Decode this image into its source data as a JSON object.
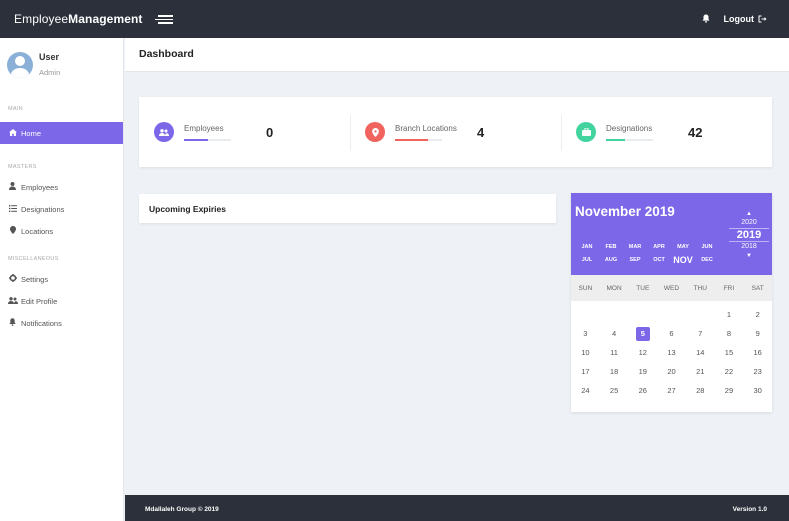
{
  "topbar": {
    "brand_light": "Employee",
    "brand_bold": "Management",
    "logout_label": "Logout"
  },
  "sidebar": {
    "user_name": "User",
    "user_role": "Admin",
    "sections": [
      {
        "label": "Main",
        "items": [
          {
            "label": "Home",
            "icon": "home-icon",
            "active": true
          }
        ]
      },
      {
        "label": "Masters",
        "items": [
          {
            "label": "Employees",
            "icon": "user-icon"
          },
          {
            "label": "Designations",
            "icon": "list-icon"
          },
          {
            "label": "Locations",
            "icon": "map-pin-icon"
          }
        ]
      },
      {
        "label": "Miscellaneous",
        "items": [
          {
            "label": "Settings",
            "icon": "gear-icon"
          },
          {
            "label": "Edit Profile",
            "icon": "users-icon"
          },
          {
            "label": "Notifications",
            "icon": "bell-icon"
          }
        ]
      }
    ]
  },
  "header": {
    "title": "Dashboard"
  },
  "stats": [
    {
      "label": "Employees",
      "value": "0",
      "color": "#7c67e8",
      "progress": 0.5,
      "icon": "users-icon"
    },
    {
      "label": "Branch Locations",
      "value": "4",
      "color": "#f0635f",
      "progress": 0.7,
      "icon": "map-pin-icon"
    },
    {
      "label": "Designations",
      "value": "42",
      "color": "#43d39e",
      "progress": 0.4,
      "icon": "briefcase-icon"
    }
  ],
  "expiries": {
    "title": "Upcoming Expiries"
  },
  "calendar": {
    "title": "November 2019",
    "months_row1": [
      "JAN",
      "FEB",
      "MAR",
      "APR",
      "MAY",
      "JUN"
    ],
    "months_row2": [
      "JUL",
      "AUG",
      "SEP",
      "OCT",
      "NOV",
      "DEC"
    ],
    "selected_month": "NOV",
    "years": [
      "2020",
      "2019",
      "2018"
    ],
    "selected_year": "2019",
    "weekdays": [
      "SUN",
      "MON",
      "TUE",
      "WED",
      "THU",
      "FRI",
      "SAT"
    ],
    "weeks": [
      [
        "",
        "",
        "",
        "",
        "",
        "1",
        "2"
      ],
      [
        "3",
        "4",
        "5",
        "6",
        "7",
        "8",
        "9"
      ],
      [
        "10",
        "11",
        "12",
        "13",
        "14",
        "15",
        "16"
      ],
      [
        "17",
        "18",
        "19",
        "20",
        "21",
        "22",
        "23"
      ],
      [
        "24",
        "25",
        "26",
        "27",
        "28",
        "29",
        "30"
      ]
    ],
    "today": "5",
    "accent": "#7c67e8"
  },
  "footer": {
    "left": "Mdallaleh Group © 2019",
    "right": "Version 1.0"
  }
}
